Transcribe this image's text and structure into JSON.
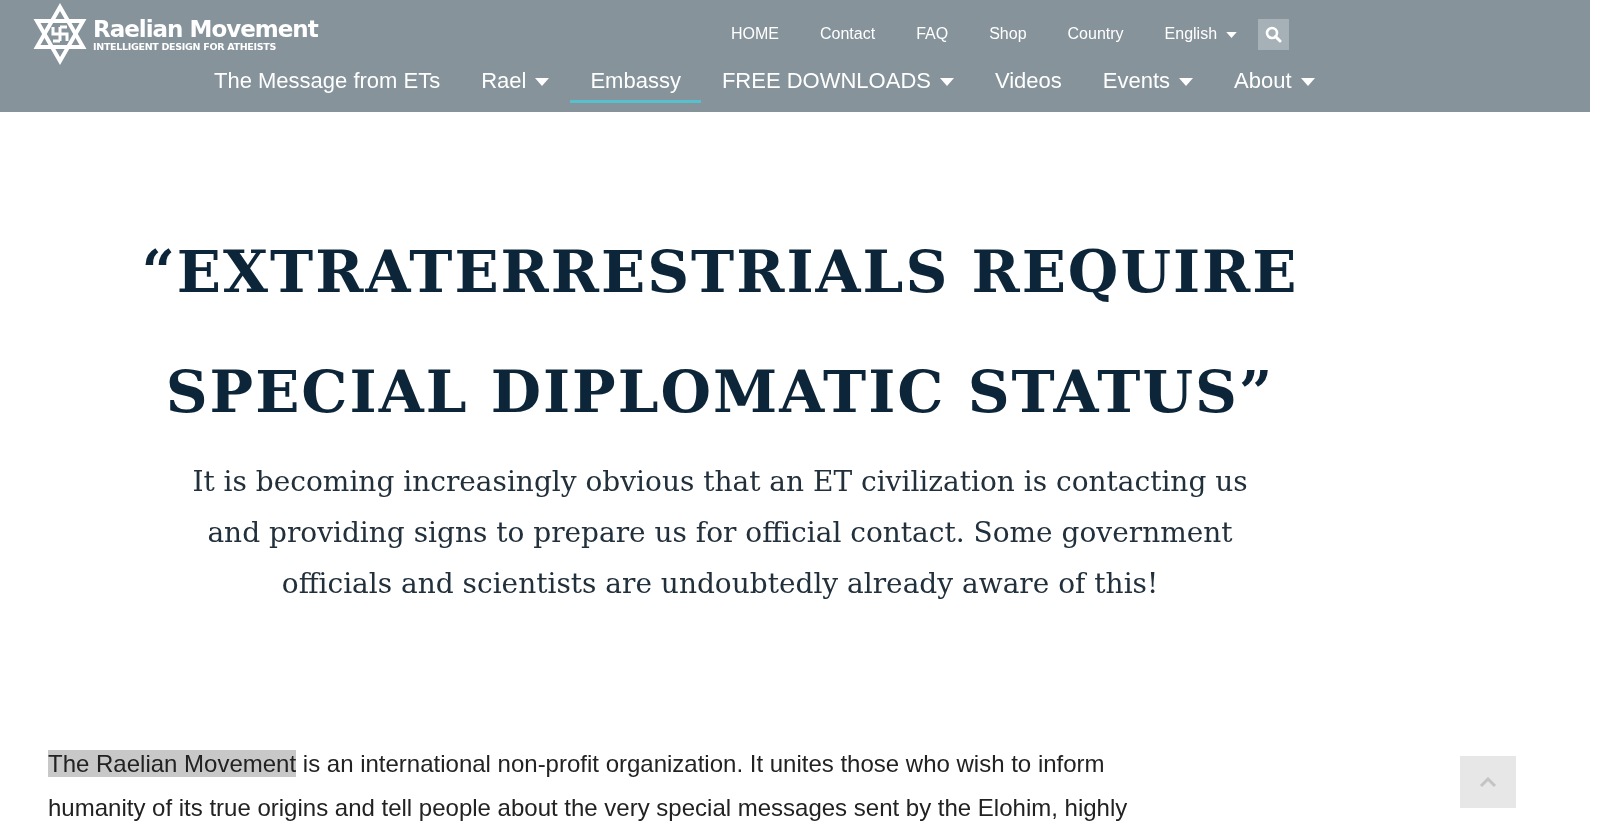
{
  "header": {
    "logo": {
      "title": "Raelian Movement",
      "tagline": "INTELLIGENT DESIGN FOR ATHEISTS"
    },
    "top_links": [
      {
        "label": "HOME",
        "dropdown": false
      },
      {
        "label": "Contact",
        "dropdown": false
      },
      {
        "label": "FAQ",
        "dropdown": false
      },
      {
        "label": "Shop",
        "dropdown": false
      },
      {
        "label": "Country",
        "dropdown": false
      },
      {
        "label": "English",
        "dropdown": true
      }
    ],
    "main_nav": [
      {
        "label": "The Message from ETs",
        "dropdown": false,
        "selected": false
      },
      {
        "label": "Rael",
        "dropdown": true,
        "selected": false
      },
      {
        "label": "Embassy",
        "dropdown": false,
        "selected": true
      },
      {
        "label": "FREE DOWNLOADS",
        "dropdown": true,
        "selected": false
      },
      {
        "label": "Videos",
        "dropdown": false,
        "selected": false
      },
      {
        "label": "Events",
        "dropdown": true,
        "selected": false
      },
      {
        "label": "About",
        "dropdown": true,
        "selected": false
      }
    ]
  },
  "headline": "“EXTRATERRESTRIALS REQUIRE SPECIAL DIPLOMATIC STATUS”",
  "subtitle": "It is becoming increasingly obvious that an ET civilization is contacting us and providing signs to prepare us for official contact. Some government officials and scientists are undoubtedly already aware of this!",
  "intro": {
    "highlighted": "The Raelian Movement",
    "lines": [
      " is an international non-profit organization. It unites those who wish to inform",
      "humanity of its true origins and tell people about the very special messages sent by the Elohim, highly"
    ]
  }
}
